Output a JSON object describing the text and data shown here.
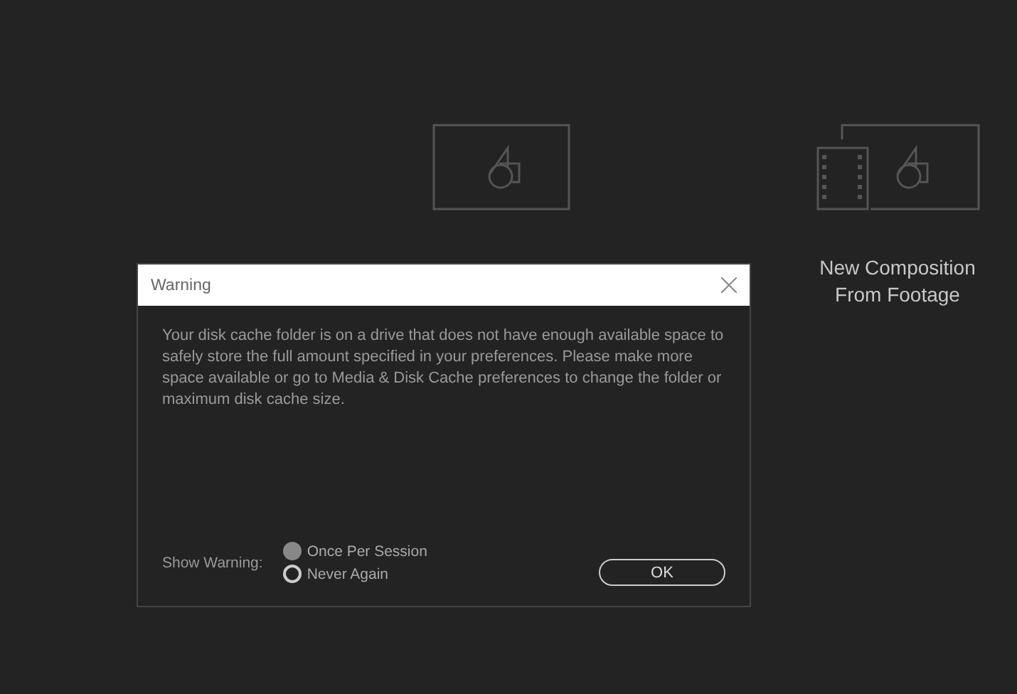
{
  "tiles": [
    {
      "kind": "composition"
    },
    {
      "kind": "footage",
      "label": "New Composition From Footage"
    }
  ],
  "dialog": {
    "title": "Warning",
    "message": "Your disk cache folder is on a drive that does not have enough available space to safely store the full amount specified in your preferences. Please make more space available or go to Media & Disk Cache preferences to change the folder or maximum disk cache size.",
    "option_label": "Show Warning:",
    "options": [
      {
        "label": "Once Per Session",
        "selected": true
      },
      {
        "label": "Never Again",
        "selected": false
      }
    ],
    "button": "OK"
  }
}
